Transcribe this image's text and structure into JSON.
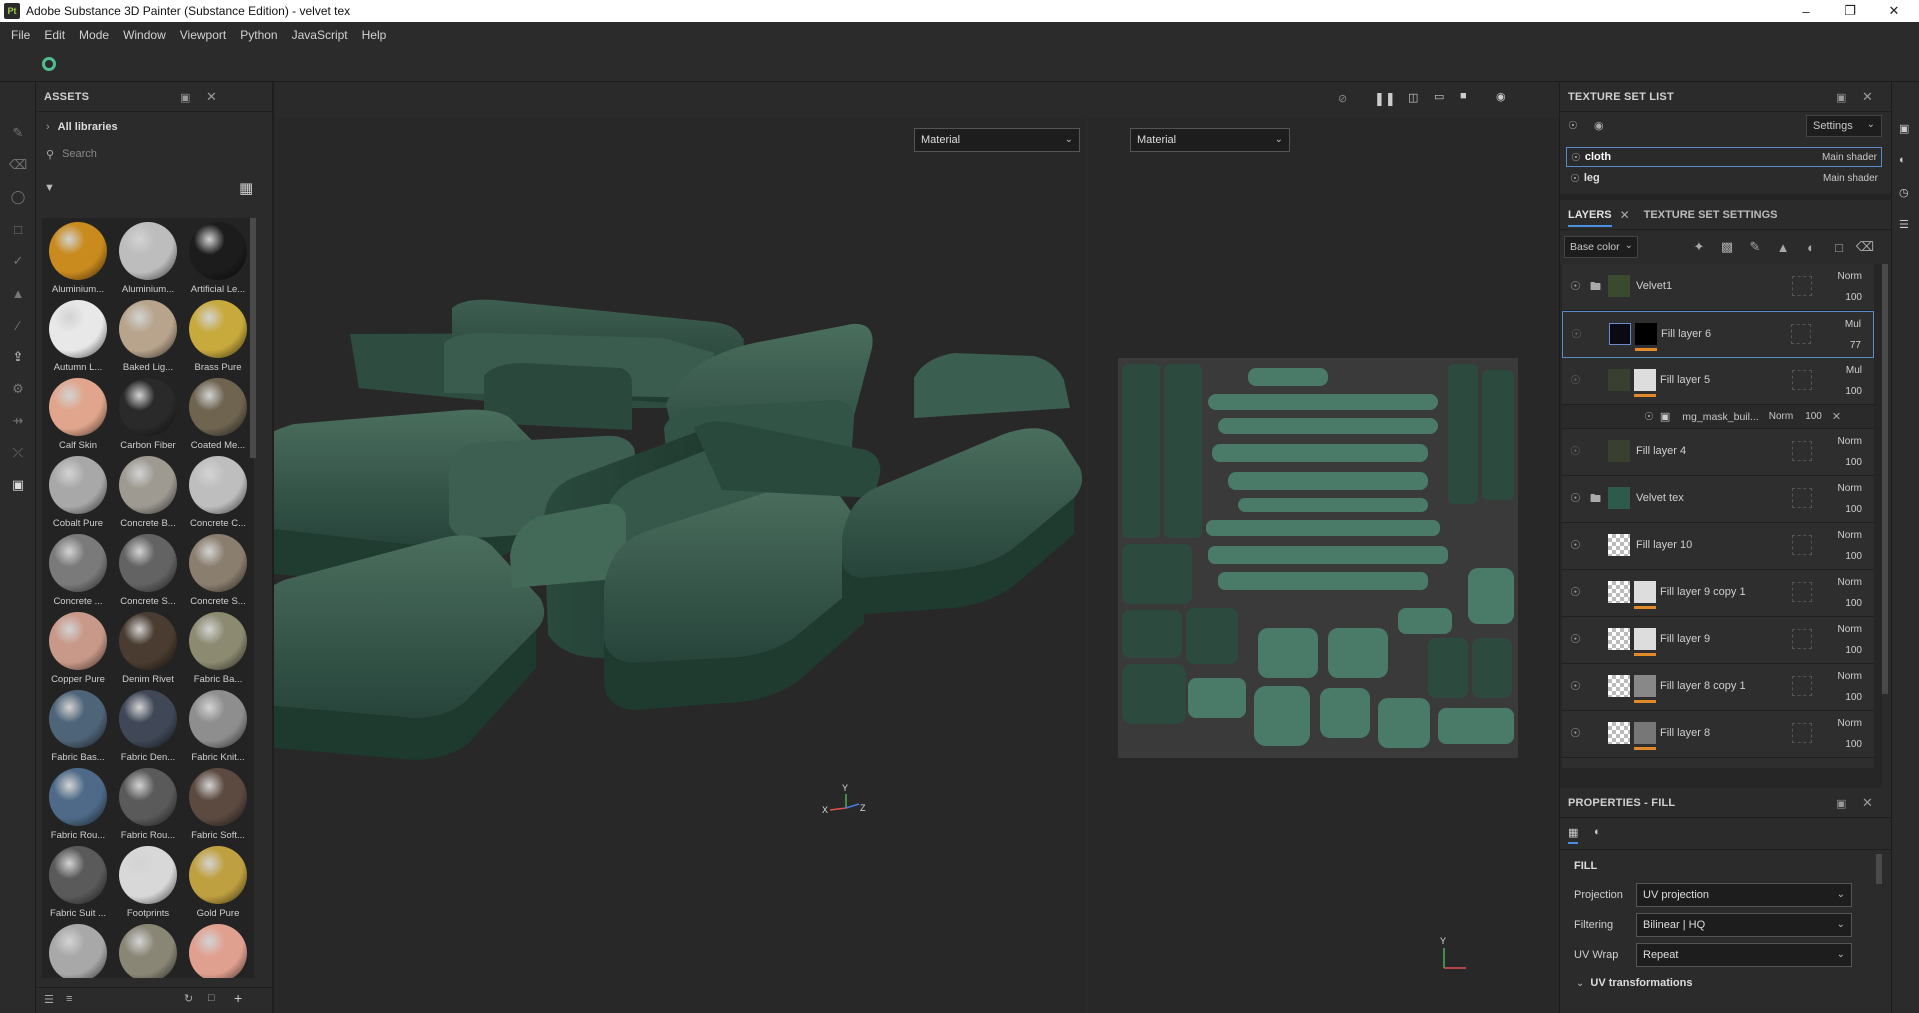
{
  "window": {
    "title": "Adobe Substance 3D Painter (Substance Edition) - velvet tex",
    "logo": "Pt"
  },
  "menu": [
    "File",
    "Edit",
    "Mode",
    "Window",
    "Viewport",
    "Python",
    "JavaScript",
    "Help"
  ],
  "assets": {
    "title": "ASSETS",
    "libraries": "All libraries",
    "search_placeholder": "Search",
    "items": [
      {
        "label": "Aluminium...",
        "color": "#c98a1e"
      },
      {
        "label": "Aluminium...",
        "color": "#bdbdbd"
      },
      {
        "label": "Artificial Le...",
        "color": "#1c1c1c"
      },
      {
        "label": "Autumn L...",
        "color": "#e8e8e8"
      },
      {
        "label": "Baked Lig...",
        "color": "#b8a48c"
      },
      {
        "label": "Brass Pure",
        "color": "#c7a93c"
      },
      {
        "label": "Calf Skin",
        "color": "#e0a58c"
      },
      {
        "label": "Carbon Fiber",
        "color": "#2a2a2a"
      },
      {
        "label": "Coated Me...",
        "color": "#6e6450"
      },
      {
        "label": "Cobalt Pure",
        "color": "#a8a8a8"
      },
      {
        "label": "Concrete B...",
        "color": "#9e9a92"
      },
      {
        "label": "Concrete C...",
        "color": "#bebebe"
      },
      {
        "label": "Concrete ...",
        "color": "#7a7a7a"
      },
      {
        "label": "Concrete S...",
        "color": "#636363"
      },
      {
        "label": "Concrete S...",
        "color": "#8a7e6e"
      },
      {
        "label": "Copper Pure",
        "color": "#c89888"
      },
      {
        "label": "Denim Rivet",
        "color": "#4a3c30"
      },
      {
        "label": "Fabric Ba...",
        "color": "#8c8a70"
      },
      {
        "label": "Fabric Bas...",
        "color": "#4e6478"
      },
      {
        "label": "Fabric Den...",
        "color": "#404858"
      },
      {
        "label": "Fabric Knit...",
        "color": "#8e8e8e"
      },
      {
        "label": "Fabric Rou...",
        "color": "#4e6a88"
      },
      {
        "label": "Fabric Rou...",
        "color": "#5a5a5a"
      },
      {
        "label": "Fabric Soft...",
        "color": "#5c4a40"
      },
      {
        "label": "Fabric Suit ...",
        "color": "#5a5a5a"
      },
      {
        "label": "Footprints",
        "color": "#d8d8d8"
      },
      {
        "label": "Gold Pure",
        "color": "#bfa040"
      },
      {
        "label": "",
        "color": "#a8a8a8"
      },
      {
        "label": "",
        "color": "#8a8676"
      },
      {
        "label": "",
        "color": "#e0a090"
      }
    ]
  },
  "viewport": {
    "left_mode": "Material",
    "right_mode": "Material",
    "axes_3d": {
      "x": "X",
      "y": "Y",
      "z": "Z"
    },
    "axes_2d": {
      "y": "Y"
    }
  },
  "texture_set_list": {
    "title": "TEXTURE SET LIST",
    "settings": "Settings",
    "sets": [
      {
        "name": "cloth",
        "shader": "Main shader"
      },
      {
        "name": "leg",
        "shader": "Main shader"
      }
    ]
  },
  "layers": {
    "tab_layers": "LAYERS",
    "tab_settings": "TEXTURE SET SETTINGS",
    "channel": "Base color",
    "items": [
      {
        "name": "Velvet1",
        "blend": "Norm",
        "opacity": "100",
        "type": "folder"
      },
      {
        "name": "Fill layer 6",
        "blend": "Mul",
        "opacity": "77",
        "type": "fill-black"
      },
      {
        "name": "Fill layer 5",
        "blend": "Mul",
        "opacity": "100",
        "type": "fill-mask"
      },
      {
        "name": "mg_mask_buil...",
        "blend": "Norm",
        "opacity": "100",
        "type": "effect"
      },
      {
        "name": "Fill layer 4",
        "blend": "Norm",
        "opacity": "100",
        "type": "fill-plain"
      },
      {
        "name": "Velvet tex",
        "blend": "Norm",
        "opacity": "100",
        "type": "folder"
      },
      {
        "name": "Fill layer 10",
        "blend": "Norm",
        "opacity": "100",
        "type": "checker"
      },
      {
        "name": "Fill layer 9 copy 1",
        "blend": "Norm",
        "opacity": "100",
        "type": "checker-white"
      },
      {
        "name": "Fill layer 9",
        "blend": "Norm",
        "opacity": "100",
        "type": "checker-white"
      },
      {
        "name": "Fill layer 8 copy 1",
        "blend": "Norm",
        "opacity": "100",
        "type": "checker-noise"
      },
      {
        "name": "Fill layer 8",
        "blend": "Norm",
        "opacity": "100",
        "type": "checker-noise"
      }
    ]
  },
  "properties": {
    "title": "PROPERTIES - FILL",
    "section": "FILL",
    "projection": {
      "label": "Projection",
      "value": "UV projection"
    },
    "filtering": {
      "label": "Filtering",
      "value": "Bilinear | HQ"
    },
    "uvwrap": {
      "label": "UV Wrap",
      "value": "Repeat"
    },
    "uv_transform": "UV transformations"
  }
}
